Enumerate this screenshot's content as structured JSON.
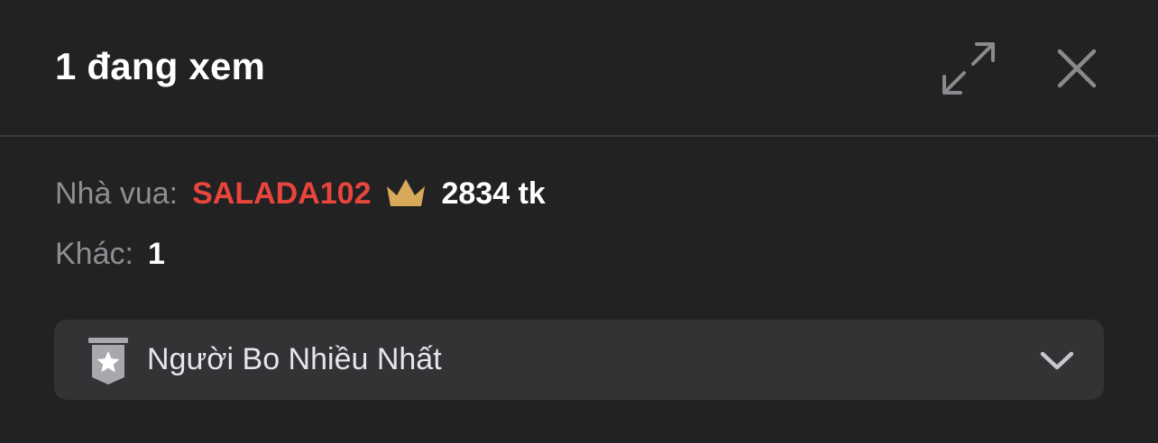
{
  "header": {
    "title": "1 đang xem",
    "expand_icon": "expand-arrows-icon",
    "close_icon": "close-icon"
  },
  "king": {
    "label": "Nhà vua:",
    "name": "SALADA102",
    "crown_icon": "crown-icon",
    "tokens": "2834 tk"
  },
  "others": {
    "label": "Khác:",
    "count": "1"
  },
  "dropdown": {
    "icon": "star-badge-icon",
    "label": "Người Bo Nhiều Nhất",
    "chevron_icon": "chevron-down-icon"
  },
  "colors": {
    "background": "#222223",
    "king_name": "#e8453c",
    "crown": "#d9a95a",
    "muted_label": "#8e8e93"
  }
}
